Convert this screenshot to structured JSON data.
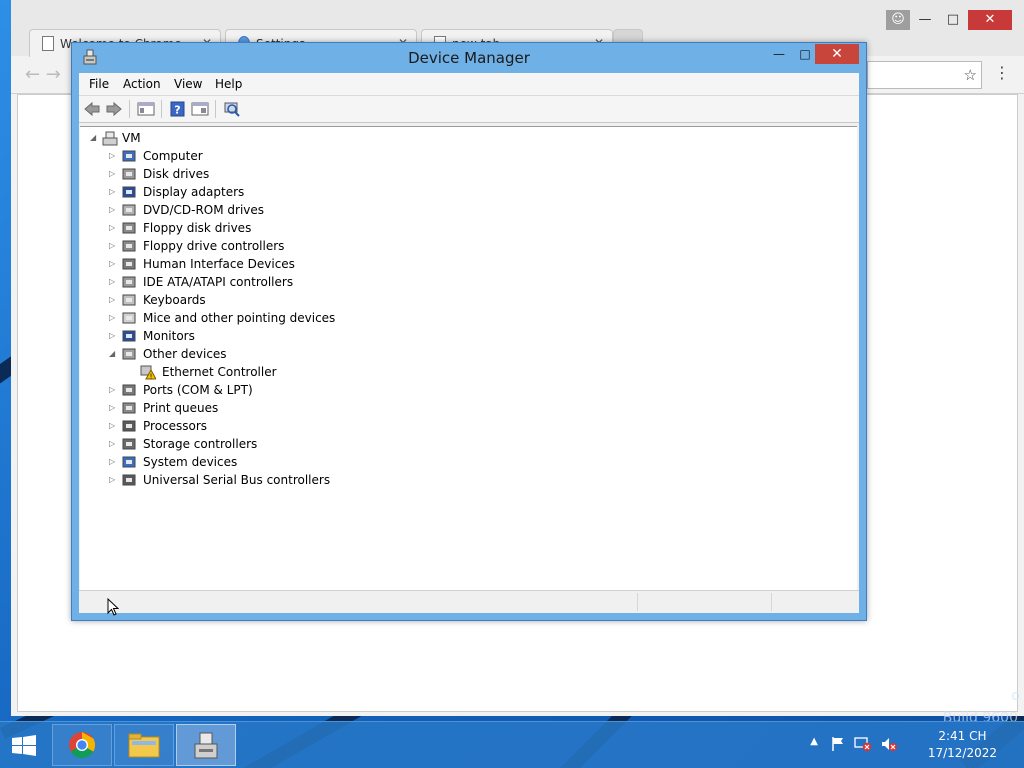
{
  "browser": {
    "tabs": [
      {
        "title": "Welcome to Chrome"
      },
      {
        "title": "Settings"
      },
      {
        "title": "new tab"
      }
    ],
    "close_glyph": "✕"
  },
  "desktop": {
    "watermark_line1": "o",
    "watermark_line2": "Build 9600"
  },
  "window": {
    "title": "Device Manager",
    "menu": [
      "File",
      "Action",
      "View",
      "Help"
    ]
  },
  "tree": {
    "root": "VM",
    "categories": [
      {
        "label": "Computer",
        "icon": "computer-icon",
        "expanded": false
      },
      {
        "label": "Disk drives",
        "icon": "disk-drive-icon",
        "expanded": false
      },
      {
        "label": "Display adapters",
        "icon": "display-adapter-icon",
        "expanded": false
      },
      {
        "label": "DVD/CD-ROM drives",
        "icon": "dvd-drive-icon",
        "expanded": false
      },
      {
        "label": "Floppy disk drives",
        "icon": "floppy-drive-icon",
        "expanded": false
      },
      {
        "label": "Floppy drive controllers",
        "icon": "floppy-controller-icon",
        "expanded": false
      },
      {
        "label": "Human Interface Devices",
        "icon": "hid-icon",
        "expanded": false
      },
      {
        "label": "IDE ATA/ATAPI controllers",
        "icon": "ide-controller-icon",
        "expanded": false
      },
      {
        "label": "Keyboards",
        "icon": "keyboard-icon",
        "expanded": false
      },
      {
        "label": "Mice and other pointing devices",
        "icon": "mouse-icon",
        "expanded": false
      },
      {
        "label": "Monitors",
        "icon": "monitor-icon",
        "expanded": false
      },
      {
        "label": "Other devices",
        "icon": "unknown-device-icon",
        "expanded": true,
        "children": [
          {
            "label": "Ethernet Controller",
            "icon": "warning-device-icon"
          }
        ]
      },
      {
        "label": "Ports (COM & LPT)",
        "icon": "port-icon",
        "expanded": false
      },
      {
        "label": "Print queues",
        "icon": "printer-icon",
        "expanded": false
      },
      {
        "label": "Processors",
        "icon": "processor-icon",
        "expanded": false
      },
      {
        "label": "Storage controllers",
        "icon": "storage-controller-icon",
        "expanded": false
      },
      {
        "label": "System devices",
        "icon": "system-device-icon",
        "expanded": false
      },
      {
        "label": "Universal Serial Bus controllers",
        "icon": "usb-icon",
        "expanded": false
      }
    ]
  },
  "taskbar": {
    "apps": [
      {
        "name": "chrome-taskbar-button",
        "icon": "chrome-icon",
        "active": false
      },
      {
        "name": "file-explorer-taskbar-button",
        "icon": "folder-icon",
        "active": false
      },
      {
        "name": "device-manager-taskbar-button",
        "icon": "device-manager-icon",
        "active": true
      }
    ],
    "time": "2:41 CH",
    "date": "17/12/2022"
  }
}
